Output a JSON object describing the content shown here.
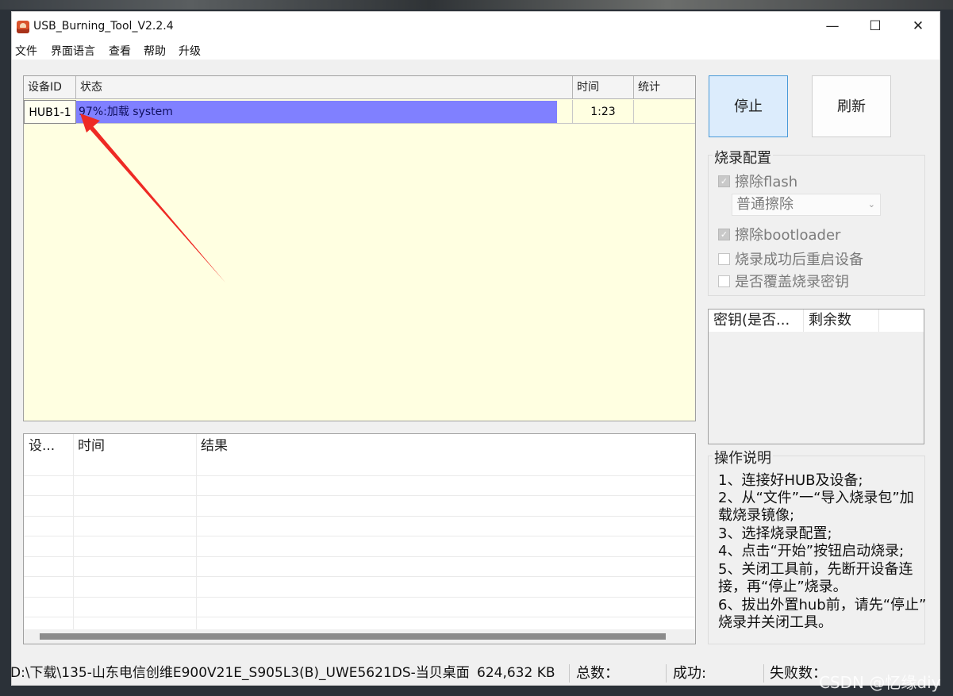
{
  "window": {
    "title": "USB_Burning_Tool_V2.2.4"
  },
  "menu": [
    "文件",
    "界面语言",
    "查看",
    "帮助",
    "升级"
  ],
  "device_grid": {
    "columns": [
      "设备ID",
      "状态",
      "时间",
      "统计"
    ],
    "rows": [
      {
        "id": "HUB1-1",
        "status": "97%:加载 system",
        "progress": 0.97,
        "time": "1:23",
        "stats": ""
      }
    ]
  },
  "log_grid": {
    "columns": [
      "设...",
      "时间",
      "结果"
    ]
  },
  "buttons": {
    "stop": "停止",
    "refresh": "刷新"
  },
  "burn_config": {
    "title": "烧录配置",
    "erase_flash": {
      "label": "擦除flash",
      "checked": true,
      "disabled": true
    },
    "erase_mode": "普通擦除",
    "erase_bootloader": {
      "label": "擦除bootloader",
      "checked": true,
      "disabled": true
    },
    "reboot_after": {
      "label": "烧录成功后重启设备",
      "checked": false,
      "disabled": true
    },
    "overwrite_key": {
      "label": "是否覆盖烧录密钥",
      "checked": false,
      "disabled": true
    }
  },
  "key_list": {
    "columns": [
      "密钥(是否...",
      "剩余数"
    ]
  },
  "instructions": {
    "title": "操作说明",
    "lines": [
      "1、连接好HUB及设备;",
      "2、从“文件”一“导入烧录包”加",
      "载烧录镜像;",
      "3、选择烧录配置;",
      "4、点击“开始”按钮启动烧录;",
      "5、关闭工具前，先断开设备连",
      "接，再“停止”烧录。",
      "6、拔出外置hub前，请先“停止”",
      "烧录并关闭工具。"
    ]
  },
  "status_bar": {
    "file": "D:\\下载\\135-山东电信创维E900V21E_S905L3(B)_UWE5621DS-当贝桌面",
    "size": "624,632 KB",
    "total": "总数：",
    "success": "成功:",
    "fail": "失败数："
  },
  "watermark": "CSDN @忆缘diy",
  "colors": {
    "grid_bg": "#ffffe1",
    "progress": "#8080ff",
    "arrow": "#ee2a24",
    "stop_btn": "#dcecfc"
  }
}
